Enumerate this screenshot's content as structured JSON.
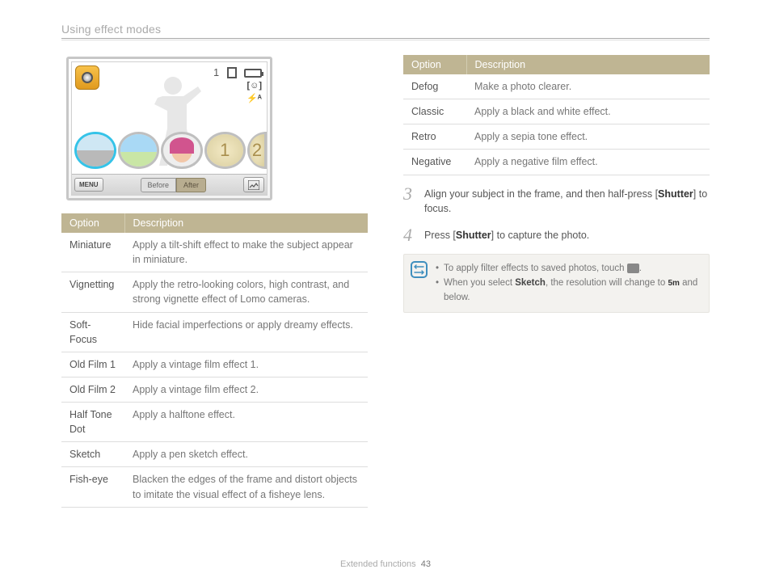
{
  "header": {
    "title": "Using effect modes"
  },
  "footer": {
    "section": "Extended functions",
    "page": "43"
  },
  "screen": {
    "count": "1",
    "menu_label": "MENU",
    "before_label": "Before",
    "after_label": "After",
    "thumb5_num": "2"
  },
  "table1": {
    "head_option": "Option",
    "head_desc": "Description",
    "rows": [
      {
        "opt": "Miniature",
        "desc": "Apply a tilt-shift effect to make the subject appear in miniature."
      },
      {
        "opt": "Vignetting",
        "desc": "Apply the retro-looking colors, high contrast, and strong vignette effect of Lomo cameras."
      },
      {
        "opt": "Soft-Focus",
        "desc": "Hide facial imperfections or apply dreamy effects."
      },
      {
        "opt": "Old Film 1",
        "desc": "Apply a vintage film effect 1."
      },
      {
        "opt": "Old Film 2",
        "desc": "Apply a vintage film effect 2."
      },
      {
        "opt": "Half Tone Dot",
        "desc": "Apply a halftone effect."
      },
      {
        "opt": "Sketch",
        "desc": "Apply a pen sketch effect."
      },
      {
        "opt": "Fish-eye",
        "desc": "Blacken the edges of the frame and distort objects to imitate the visual effect of a fisheye lens."
      }
    ]
  },
  "table2": {
    "head_option": "Option",
    "head_desc": "Description",
    "rows": [
      {
        "opt": "Defog",
        "desc": "Make a photo clearer."
      },
      {
        "opt": "Classic",
        "desc": "Apply a black and white effect."
      },
      {
        "opt": "Retro",
        "desc": "Apply a sepia tone effect."
      },
      {
        "opt": "Negative",
        "desc": "Apply a negative film effect."
      }
    ]
  },
  "steps": {
    "s3_num": "3",
    "s3_a": "Align your subject in the frame, and then half-press [",
    "s3_b": "Shutter",
    "s3_c": "] to focus.",
    "s4_num": "4",
    "s4_a": "Press [",
    "s4_b": "Shutter",
    "s4_c": "] to capture the photo."
  },
  "note": {
    "l1_a": "To apply filter effects to saved photos, touch ",
    "l1_b": ".",
    "l2_a": "When you select ",
    "l2_b": "Sketch",
    "l2_c": ", the resolution will change to ",
    "l2_d": "5m",
    "l2_e": " and below."
  }
}
